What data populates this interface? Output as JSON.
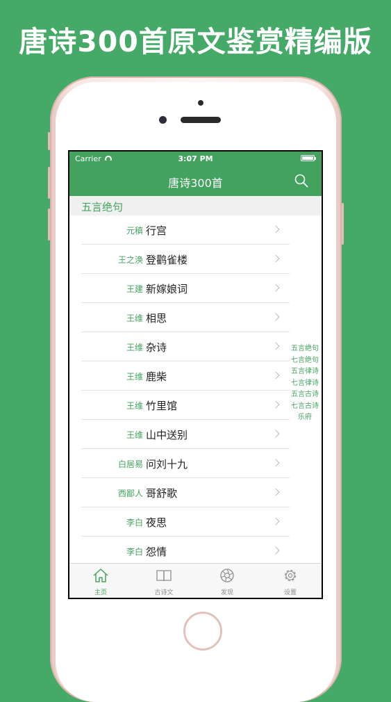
{
  "promo": {
    "title": "唐诗300首原文鉴赏精编版"
  },
  "status_bar": {
    "carrier": "Carrier",
    "time": "3:07 PM"
  },
  "nav": {
    "title": "唐诗300首"
  },
  "section": {
    "title": "五言绝句"
  },
  "poems": [
    {
      "author": "元稹",
      "title": "行宫"
    },
    {
      "author": "王之涣",
      "title": "登鹳雀楼"
    },
    {
      "author": "王建",
      "title": "新嫁娘词"
    },
    {
      "author": "王维",
      "title": "相思"
    },
    {
      "author": "王维",
      "title": "杂诗"
    },
    {
      "author": "王维",
      "title": "鹿柴"
    },
    {
      "author": "王维",
      "title": "竹里馆"
    },
    {
      "author": "王维",
      "title": "山中送别"
    },
    {
      "author": "白居易",
      "title": "问刘十九"
    },
    {
      "author": "西鄙人",
      "title": "哥舒歌"
    },
    {
      "author": "李白",
      "title": "夜思"
    },
    {
      "author": "李白",
      "title": "怨情"
    }
  ],
  "section_index": [
    "五言绝句",
    "七言绝句",
    "五言律诗",
    "七言律诗",
    "五言古诗",
    "七言古诗",
    "乐府"
  ],
  "tabs": [
    {
      "label": "主页",
      "icon": "home-icon",
      "active": true
    },
    {
      "label": "古诗文",
      "icon": "book-icon",
      "active": false
    },
    {
      "label": "发现",
      "icon": "aperture-icon",
      "active": false
    },
    {
      "label": "设置",
      "icon": "gear-icon",
      "active": false
    }
  ],
  "colors": {
    "background": "#45a968",
    "accent": "#43a35e",
    "phone_frame": "#f7e7e3"
  }
}
